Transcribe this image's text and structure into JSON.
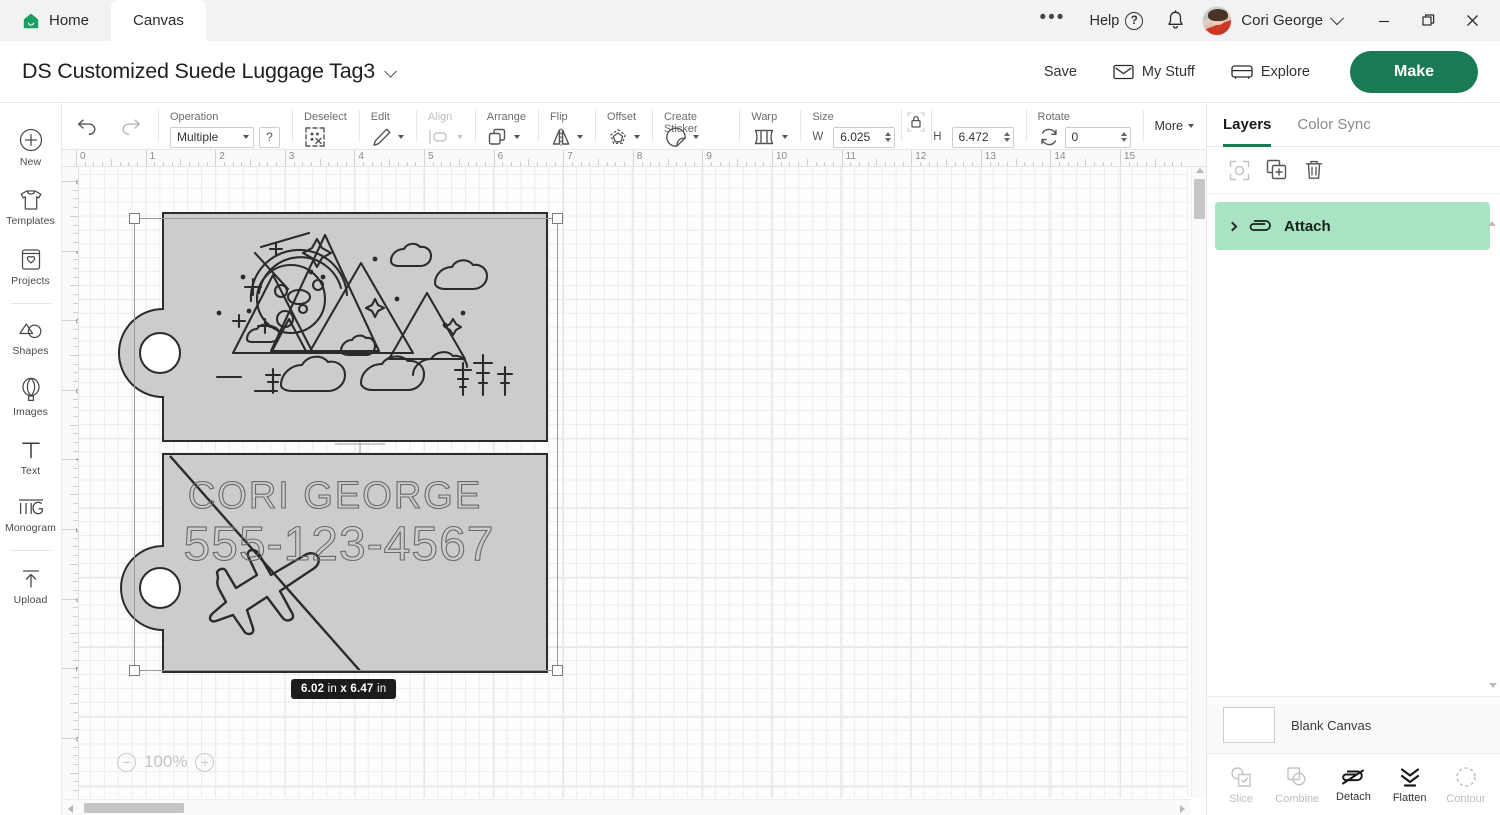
{
  "titlebar": {
    "tabs": [
      {
        "label": "Home",
        "icon": "home-icon",
        "active": false
      },
      {
        "label": "Canvas",
        "icon": "",
        "active": true
      }
    ],
    "overflow_icon": "ellipsis-icon",
    "help_label": "Help",
    "help_icon": "question-circle-icon",
    "notifications_icon": "bell-icon",
    "user_name": "Cori George",
    "user_avatar": "avatar",
    "user_chevron": "chevron-down-icon",
    "window_controls": [
      "minimize-icon",
      "restore-icon",
      "close-icon"
    ]
  },
  "project_header": {
    "title": "DS Customized Suede Luggage Tag3",
    "title_chevron": "chevron-down-icon",
    "actions": [
      {
        "label": "Save",
        "icon": ""
      },
      {
        "label": "My Stuff",
        "icon": "envelope-icon"
      },
      {
        "label": "Explore",
        "icon": "compass-icon"
      }
    ],
    "make_label": "Make",
    "make_color": "#1a7a54"
  },
  "left_rail": {
    "items": [
      {
        "label": "New",
        "icon": "plus-circle-icon"
      },
      {
        "label": "Templates",
        "icon": "tshirt-icon"
      },
      {
        "label": "Projects",
        "icon": "projects-icon"
      },
      {
        "label": "Shapes",
        "icon": "shapes-icon"
      },
      {
        "label": "Images",
        "icon": "hot-air-balloon-icon"
      },
      {
        "label": "Text",
        "icon": "text-t-icon"
      },
      {
        "label": "Monogram",
        "icon": "monogram-icon"
      },
      {
        "label": "Upload",
        "icon": "upload-arrow-icon"
      }
    ]
  },
  "toolbar": {
    "undo_icon": "undo-icon",
    "redo_icon": "redo-icon",
    "operation": {
      "label": "Operation",
      "value": "Multiple",
      "help_label": "?"
    },
    "deselect": {
      "label": "Deselect",
      "icon": "deselect-icon"
    },
    "edit": {
      "label": "Edit",
      "icon": "pencil-icon"
    },
    "align": {
      "label": "Align",
      "icon": "align-icon",
      "disabled": true
    },
    "arrange": {
      "label": "Arrange",
      "icon": "arrange-icon"
    },
    "flip": {
      "label": "Flip",
      "icon": "flip-icon"
    },
    "offset": {
      "label": "Offset",
      "icon": "offset-icon"
    },
    "create_sticker": {
      "label": "Create Sticker",
      "icon": "sticker-icon"
    },
    "warp": {
      "label": "Warp",
      "icon": "warp-icon"
    },
    "size": {
      "label": "Size",
      "w_label": "W",
      "w_value": "6.025",
      "h_label": "H",
      "h_value": "6.472",
      "lock_icon": "lock-icon"
    },
    "rotate": {
      "label": "Rotate",
      "value": "0",
      "icon": "rotate-icon"
    },
    "more": {
      "label": "More"
    }
  },
  "canvas": {
    "ruler_h_ticks": [
      "0",
      "1",
      "2",
      "3",
      "4",
      "5",
      "6",
      "7",
      "8",
      "9",
      "10",
      "11",
      "12",
      "13",
      "14",
      "15"
    ],
    "ruler_v_ticks": [
      "0",
      "1",
      "2",
      "3",
      "4",
      "5",
      "6",
      "7",
      "8"
    ],
    "size_badge": {
      "width": "6.02",
      "height": "6.47",
      "unit": "in",
      "text": "6.02 in x 6.47 in"
    },
    "zoom": {
      "level": "100%",
      "zoom_out_icon": "minus-circle-icon",
      "zoom_in_icon": "plus-circle-icon"
    },
    "design": {
      "tag_fill": "#cccccc",
      "stroke": "#2b2b2b",
      "name_text": "CORI GEORGE",
      "phone_text": "555-123-4567",
      "motifs": [
        "mountains",
        "clouds",
        "stars",
        "trees",
        "planet",
        "airplane"
      ]
    }
  },
  "right_panel": {
    "tabs": [
      {
        "label": "Layers",
        "active": true
      },
      {
        "label": "Color Sync",
        "active": false
      }
    ],
    "tools": [
      {
        "icon": "group-select-icon",
        "disabled": true
      },
      {
        "icon": "duplicate-icon",
        "disabled": false
      },
      {
        "icon": "trash-icon",
        "disabled": false
      }
    ],
    "layers": [
      {
        "label": "Attach",
        "icon": "paperclip-icon",
        "selected": true,
        "expand_icon": "chevron-right-icon",
        "highlight": "#a9e3c4"
      }
    ],
    "blank_canvas": {
      "label": "Blank Canvas",
      "swatch": "#ffffff"
    },
    "bottom_tools": [
      {
        "label": "Slice",
        "icon": "slice-icon",
        "disabled": true
      },
      {
        "label": "Combine",
        "icon": "combine-icon",
        "disabled": true
      },
      {
        "label": "Detach",
        "icon": "detach-icon",
        "disabled": false
      },
      {
        "label": "Flatten",
        "icon": "flatten-icon",
        "disabled": false
      },
      {
        "label": "Contour",
        "icon": "contour-icon",
        "disabled": true
      }
    ]
  }
}
